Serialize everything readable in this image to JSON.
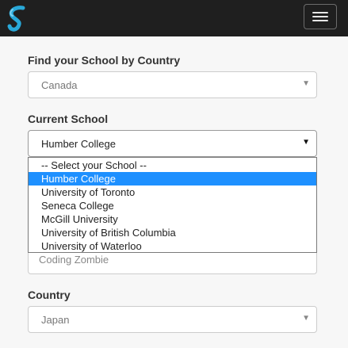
{
  "navbar": {
    "logo_icon": "s-logo-icon",
    "menu_icon": "hamburger-menu-icon",
    "brand_color": "#29a8d8"
  },
  "form": {
    "country_filter": {
      "label": "Find your School by Country",
      "value": "Canada"
    },
    "current_school": {
      "label": "Current School",
      "value": "Humber College",
      "options": [
        "-- Select your School --",
        "Humber College",
        "University of Toronto",
        "Seneca College",
        "McGill University",
        "University of British Columbia",
        "University of Waterloo"
      ],
      "selected_index": 1
    },
    "obscured_field": {
      "value": "Coding Zombie"
    },
    "country": {
      "label": "Country",
      "value": "Japan"
    }
  },
  "colors": {
    "navbar_bg": "#1f1f1f",
    "selection": "#1e90ff"
  }
}
